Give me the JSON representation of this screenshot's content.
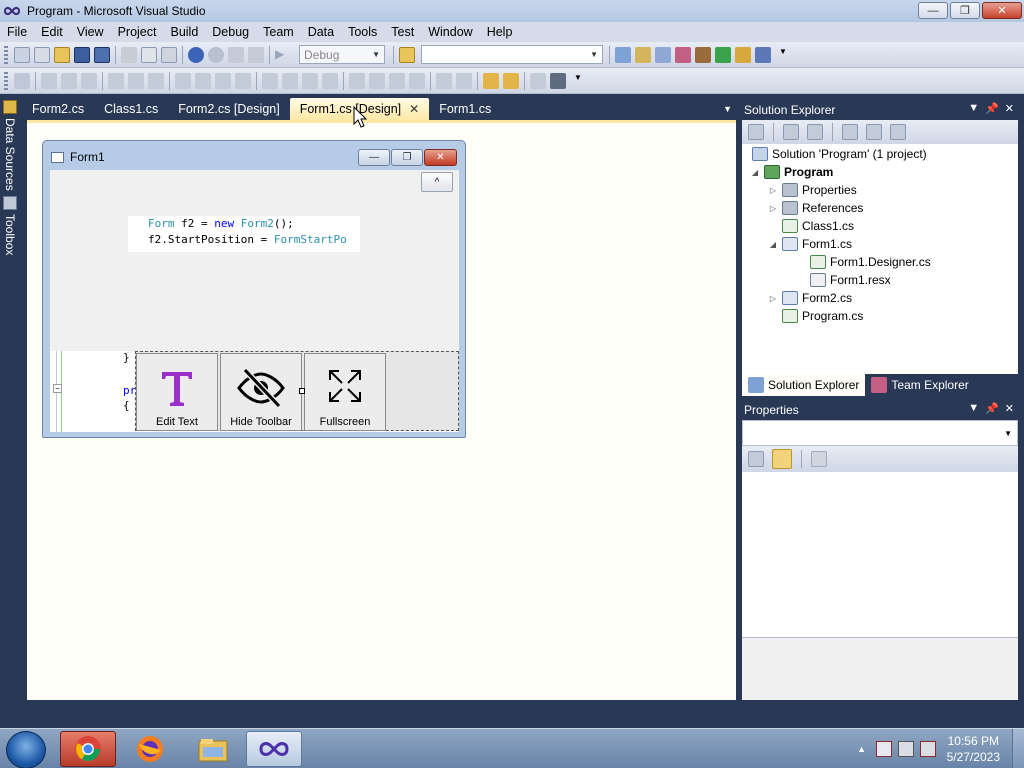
{
  "window": {
    "title": "Program - Microsoft Visual Studio",
    "controls": {
      "minimize": "—",
      "maximize": "❐",
      "close": "✕"
    }
  },
  "menu": [
    "File",
    "Edit",
    "View",
    "Project",
    "Build",
    "Debug",
    "Team",
    "Data",
    "Tools",
    "Test",
    "Window",
    "Help"
  ],
  "toolbar": {
    "config_combo": "Debug",
    "platform_combo": ""
  },
  "left_tabs": {
    "data_sources": "Data Sources",
    "toolbox": "Toolbox"
  },
  "doc_tabs": [
    {
      "label": "Form2.cs"
    },
    {
      "label": "Class1.cs"
    },
    {
      "label": "Form2.cs [Design]"
    },
    {
      "label": "Form1.cs [Design]",
      "active": true
    },
    {
      "label": "Form1.cs"
    }
  ],
  "form1": {
    "title": "Form1",
    "collapse_label": "^",
    "code_line1": {
      "t1": "Form",
      "t2": " f2 = ",
      "t3": "new",
      "t4": " ",
      "t5": "Form2",
      "t6": "();"
    },
    "code_line2": {
      "t1": "f2.StartPosition = ",
      "t2": "FormStartPo"
    },
    "lower_code": {
      "brace_close": "}",
      "pr": "pr",
      "brace_open": "{"
    },
    "toolbar_buttons": [
      {
        "label": "Edit Text",
        "icon": "text-t-icon"
      },
      {
        "label": "Hide Toolbar",
        "icon": "eye-slash-icon"
      },
      {
        "label": "Fullscreen",
        "icon": "fullscreen-icon"
      }
    ]
  },
  "solution_explorer": {
    "title": "Solution Explorer",
    "items": [
      {
        "label": "Solution 'Program' (1 project)",
        "icon": "solution-icon"
      },
      {
        "label": "Program",
        "icon": "csharp-project-icon",
        "bold": true
      },
      {
        "label": "Properties",
        "icon": "properties-folder-icon"
      },
      {
        "label": "References",
        "icon": "references-icon"
      },
      {
        "label": "Class1.cs",
        "icon": "cs-file-icon"
      },
      {
        "label": "Form1.cs",
        "icon": "form-icon"
      },
      {
        "label": "Form1.Designer.cs",
        "icon": "cs-file-icon"
      },
      {
        "label": "Form1.resx",
        "icon": "resx-icon"
      },
      {
        "label": "Form2.cs",
        "icon": "form-icon"
      },
      {
        "label": "Program.cs",
        "icon": "cs-file-icon"
      }
    ],
    "tabs": [
      {
        "label": "Solution Explorer",
        "active": true
      },
      {
        "label": "Team Explorer"
      }
    ]
  },
  "properties": {
    "title": "Properties",
    "combo_value": ""
  },
  "taskbar": {
    "time": "10:56 PM",
    "date": "5/27/2023",
    "apps": [
      "chrome-icon",
      "firefox-icon",
      "file-explorer-icon",
      "visual-studio-icon"
    ]
  },
  "colors": {
    "chrome_bg": "#293955",
    "active_tab": "#ffe8a6",
    "designer_bg": "#fffef8",
    "keyword": "#0000ff",
    "type": "#2b91af",
    "edit_text_icon": "#9b30c8"
  }
}
